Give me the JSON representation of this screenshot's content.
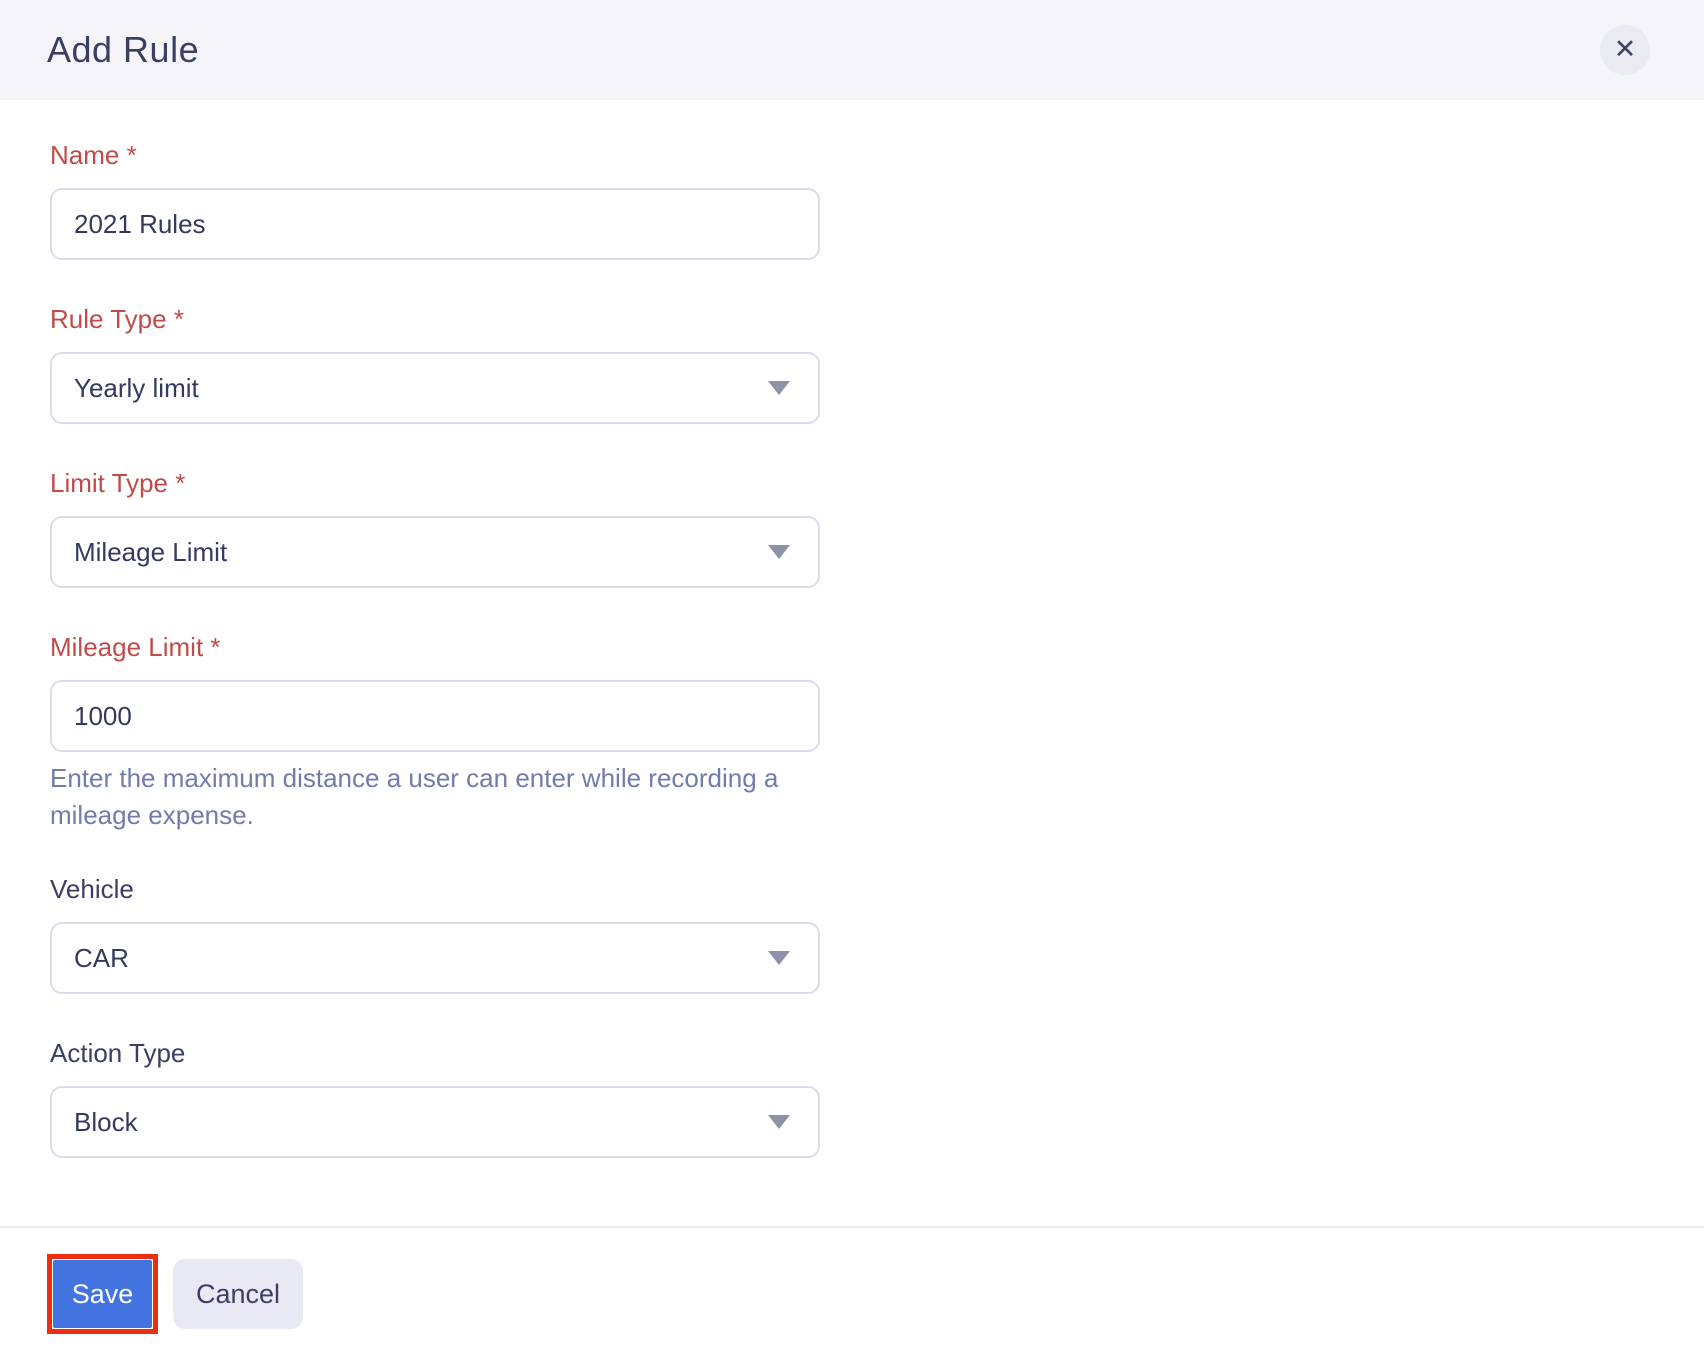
{
  "header": {
    "title": "Add Rule",
    "close_icon": "✕"
  },
  "form": {
    "fields": [
      {
        "label": "Name *",
        "required": true,
        "type": "text",
        "value": "2021 Rules"
      },
      {
        "label": "Rule Type *",
        "required": true,
        "type": "select",
        "value": "Yearly limit"
      },
      {
        "label": "Limit Type *",
        "required": true,
        "type": "select",
        "value": "Mileage Limit"
      },
      {
        "label": "Mileage Limit *",
        "required": true,
        "type": "text",
        "value": "1000",
        "helper": "Enter the maximum distance a user can enter while recording a mileage expense."
      },
      {
        "label": "Vehicle",
        "required": false,
        "type": "select",
        "value": "CAR"
      },
      {
        "label": "Action Type",
        "required": false,
        "type": "select",
        "value": "Block"
      }
    ]
  },
  "footer": {
    "save_label": "Save",
    "cancel_label": "Cancel"
  },
  "colors": {
    "header_bg": "#f5f5f9",
    "required_label": "#bf4c4a",
    "accent_blue": "#4273e0",
    "highlight_outline": "#ec2d0f",
    "input_border": "#d9dcec",
    "helper_text": "#737aac"
  }
}
